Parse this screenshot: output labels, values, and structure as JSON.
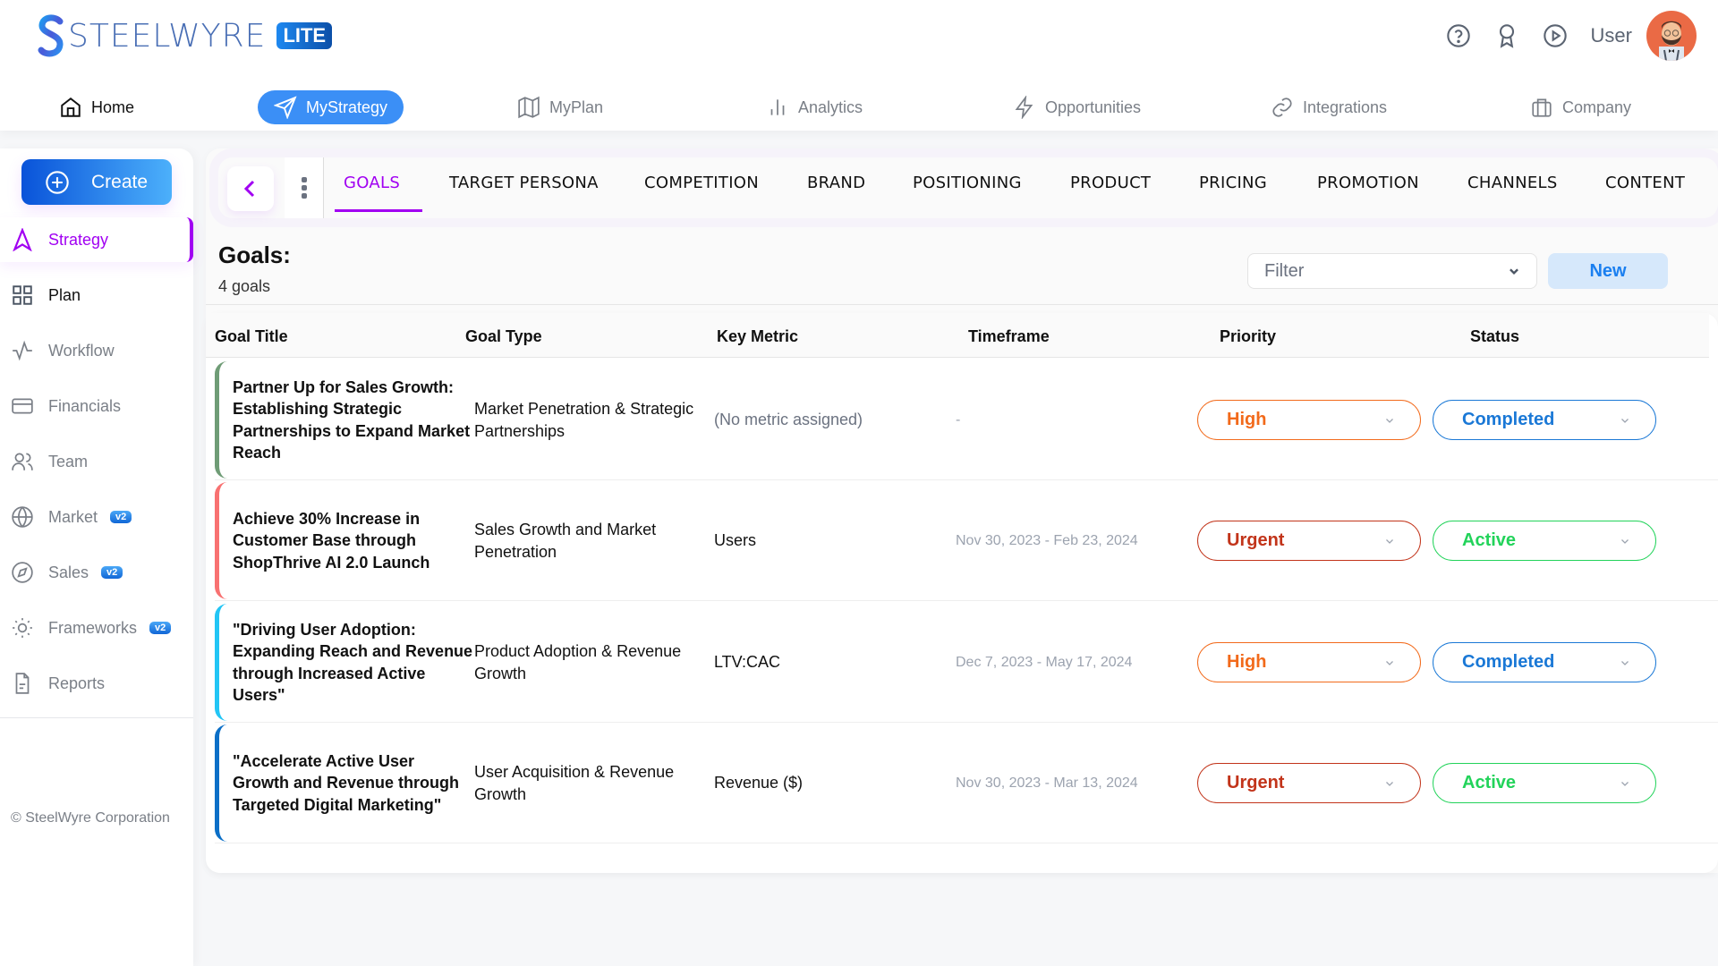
{
  "brand": {
    "name": "STEELWYRE",
    "badge": "LITE"
  },
  "header": {
    "user_label": "User",
    "icons": [
      "help-icon",
      "award-icon",
      "play-icon"
    ]
  },
  "nav": [
    {
      "label": "Home",
      "icon": "home-icon",
      "active": false
    },
    {
      "label": "MyStrategy",
      "icon": "send-icon",
      "active": true
    },
    {
      "label": "MyPlan",
      "icon": "map-icon",
      "active": false
    },
    {
      "label": "Analytics",
      "icon": "bar-chart-icon",
      "active": false
    },
    {
      "label": "Opportunities",
      "icon": "zap-icon",
      "active": false
    },
    {
      "label": "Integrations",
      "icon": "link-icon",
      "active": false
    },
    {
      "label": "Company",
      "icon": "briefcase-icon",
      "active": false
    }
  ],
  "sidebar": {
    "create_label": "Create",
    "items": [
      {
        "label": "Strategy",
        "icon": "navigation-icon",
        "active": true
      },
      {
        "label": "Plan",
        "icon": "grid-icon"
      },
      {
        "label": "Workflow",
        "icon": "activity-icon"
      },
      {
        "label": "Financials",
        "icon": "credit-card-icon"
      },
      {
        "label": "Team",
        "icon": "users-icon"
      },
      {
        "label": "Market",
        "icon": "globe-icon",
        "badge": "v2"
      },
      {
        "label": "Sales",
        "icon": "compass-icon",
        "badge": "v2"
      },
      {
        "label": "Frameworks",
        "icon": "sun-icon",
        "badge": "v2"
      },
      {
        "label": "Reports",
        "icon": "file-icon"
      }
    ],
    "copyright": "© SteelWyre Corporation"
  },
  "tabs": [
    "GOALS",
    "TARGET PERSONA",
    "COMPETITION",
    "BRAND",
    "POSITIONING",
    "PRODUCT",
    "PRICING",
    "PROMOTION",
    "CHANNELS",
    "CONTENT"
  ],
  "active_tab": "GOALS",
  "goals": {
    "title": "Goals:",
    "count": "4 goals",
    "filter_placeholder": "Filter",
    "new_label": "New",
    "columns": [
      "Goal Title",
      "Goal Type",
      "Key Metric",
      "Timeframe",
      "Priority",
      "Status"
    ],
    "rows": [
      {
        "title": "Partner Up for Sales Growth: Establishing Strategic Partnerships to Expand Market Reach",
        "type": "Market Penetration & Strategic Partnerships",
        "metric": "(No metric assigned)",
        "timeframe": "-",
        "priority": "High",
        "status": "Completed",
        "accent": "#6f9c76"
      },
      {
        "title": "Achieve 30% Increase in Customer Base through ShopThrive AI 2.0 Launch",
        "type": "Sales Growth and Market Penetration",
        "metric": "Users",
        "timeframe": "Nov 30, 2023 - Feb 23, 2024",
        "priority": "Urgent",
        "status": "Active",
        "accent": "#f87171"
      },
      {
        "title": "\"Driving User Adoption: Expanding Reach and Revenue through Increased Active Users\"",
        "type": "Product Adoption & Revenue Growth",
        "metric": "LTV:CAC",
        "timeframe": "Dec 7, 2023 - May 17, 2024",
        "priority": "High",
        "status": "Completed",
        "accent": "#22c5f5"
      },
      {
        "title": "\"Accelerate Active User Growth and Revenue through Targeted Digital Marketing\"",
        "type": "User Acquisition & Revenue Growth",
        "metric": "Revenue ($)",
        "timeframe": "Nov 30, 2023 - Mar 13, 2024",
        "priority": "Urgent",
        "status": "Active",
        "accent": "#0b6fc7"
      }
    ]
  },
  "colors": {
    "accent_purple": "#a100f2",
    "accent_blue": "#3b8ff6",
    "priority_high": "#f26a1b",
    "priority_urgent": "#c2341a",
    "status_completed": "#1a78d6",
    "status_active": "#22d35a"
  }
}
